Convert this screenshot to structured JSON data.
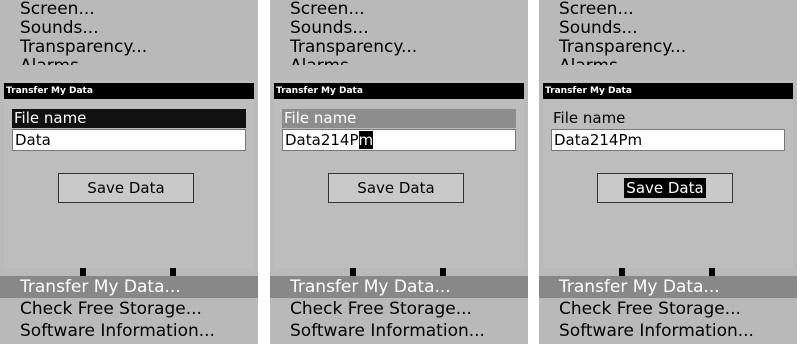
{
  "menu": {
    "top_items": [
      "Screen...",
      "Sounds...",
      "Transparency...",
      "Alarms"
    ],
    "bottom_items": [
      "Transfer My Data...",
      "Check Free Storage...",
      "Software Information..."
    ]
  },
  "panels": [
    {
      "dialog_title": "Transfer My Data",
      "file_name_label": "File name",
      "file_name_value": "Data",
      "cursor_char": "",
      "save_label": "Save Data",
      "label_state": "selected-dark",
      "save_focused": false
    },
    {
      "dialog_title": "Transfer My Data",
      "file_name_label": "File name",
      "file_name_value": "Data214P",
      "cursor_char": "m",
      "save_label": "Save Data",
      "label_state": "selected-gray",
      "save_focused": false
    },
    {
      "dialog_title": "Transfer My Data",
      "file_name_label": "File name",
      "file_name_value": "Data214Pm",
      "cursor_char": "",
      "save_label": "Save Data",
      "label_state": "plain",
      "save_focused": true
    }
  ]
}
